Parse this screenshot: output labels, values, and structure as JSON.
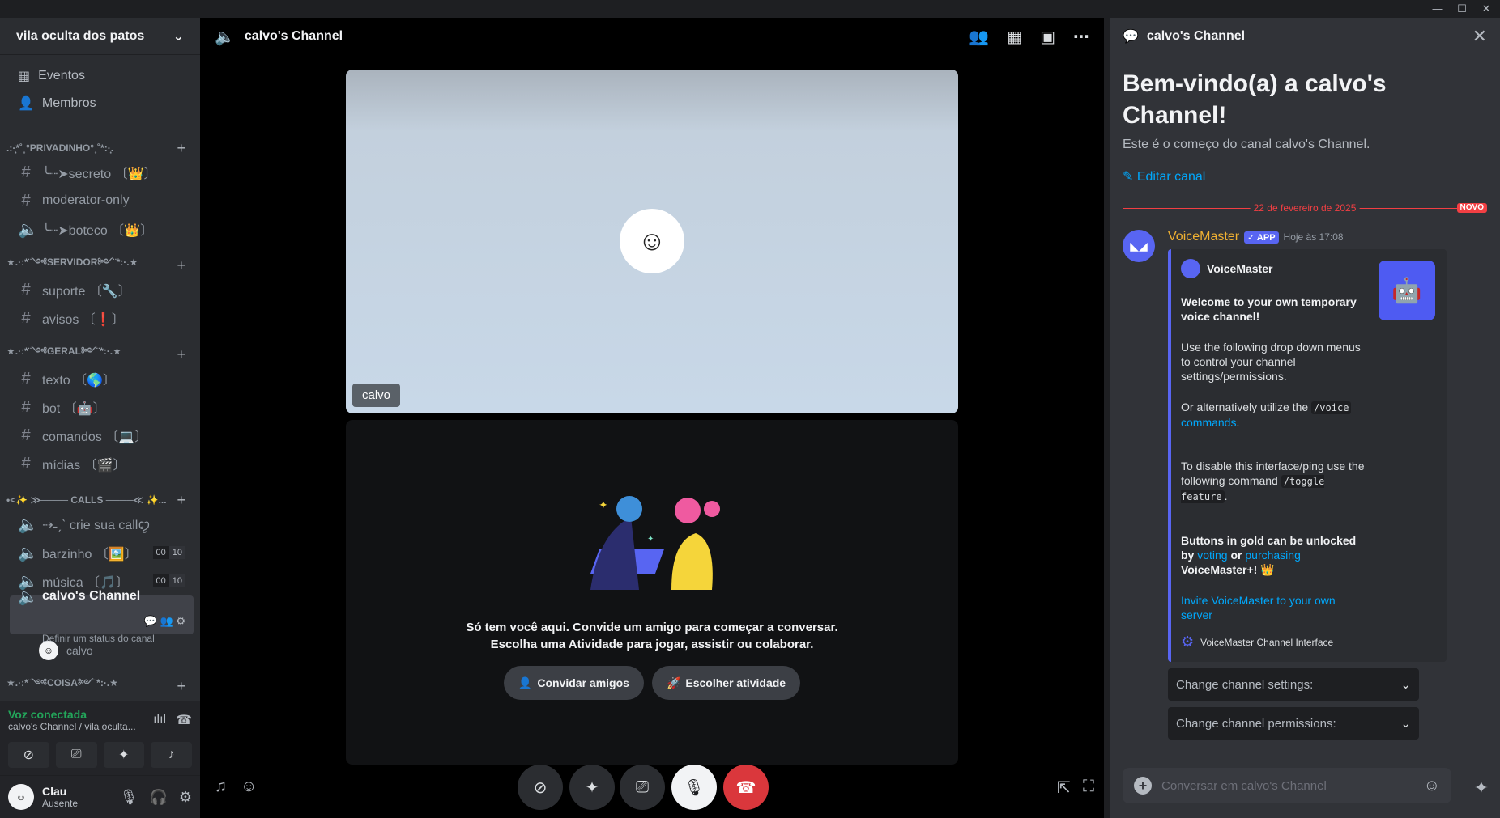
{
  "window": {
    "minimize": "—",
    "maximize": "☐",
    "close": "✕"
  },
  "sidebar": {
    "server_name": "vila oculta dos patos",
    "nav": [
      {
        "icon": "calendar-icon",
        "label": "Eventos"
      },
      {
        "icon": "members-icon",
        "label": "Membros"
      }
    ],
    "categories": [
      {
        "name": ".:·̩͙*˚˳°PRIVADINHO°˳˚*:·̩͙.",
        "channels": [
          {
            "type": "text-locked",
            "label": "╰┈➤secreto 〔👑〕"
          },
          {
            "type": "text",
            "label": "moderator-only"
          },
          {
            "type": "voice-locked",
            "label": "╰┈➤boteco 〔👑〕"
          }
        ]
      },
      {
        "name": "★.·:*¨༺SERVIDOR༻¨*:·.★",
        "channels": [
          {
            "type": "text",
            "label": "suporte 〔🔧〕"
          },
          {
            "type": "text",
            "label": "avisos 〔❗〕"
          }
        ]
      },
      {
        "name": "★.·:*¨༺GERAL༻¨*:·.★",
        "channels": [
          {
            "type": "text",
            "label": "texto 〔🌎〕"
          },
          {
            "type": "text",
            "label": "bot 〔🤖〕"
          },
          {
            "type": "text",
            "label": "comandos 〔💻〕"
          },
          {
            "type": "text",
            "label": "mídias 〔🎬〕"
          }
        ]
      },
      {
        "name": "•<✨ ≫──── CALLS ────≪ ✨...",
        "channels": [
          {
            "type": "voice",
            "label": "⇢˗ˏˋ crie sua callꨄ"
          },
          {
            "type": "voice",
            "label": "barzinho 〔🖼️〕",
            "count": "00",
            "limit": "10"
          },
          {
            "type": "voice",
            "label": "música 〔🎵〕",
            "count": "00",
            "limit": "10"
          }
        ]
      }
    ],
    "active_channel": {
      "label": "calvo's Channel",
      "status": "Definir um status do canal"
    },
    "active_member": "calvo",
    "collapsed_category": "★.·:*¨༺COISA༻¨*:·.★",
    "voice_status": "Voz conectada",
    "voice_location": "calvo's Channel / vila oculta...",
    "user": {
      "name": "Clau",
      "status": "Ausente"
    }
  },
  "main": {
    "channel_title": "calvo's Channel",
    "tile_name": "calvo",
    "empty_line1": "Só tem você aqui. Convide um amigo para começar a conversar.",
    "empty_line2": "Escolha uma Atividade para jogar, assistir ou colaborar.",
    "invite_btn": "Convidar amigos",
    "activity_btn": "Escolher atividade"
  },
  "panel": {
    "title": "calvo's Channel",
    "welcome": "Bem-vindo(a) a calvo's Channel!",
    "desc": "Este é o começo do canal calvo's Channel.",
    "edit": "Editar canal",
    "date_divider": "22 de fevereiro de 2025",
    "new_badge": "NOVO",
    "message": {
      "author": "VoiceMaster",
      "app_tag": "✓ APP",
      "timestamp": "Hoje às 17:08",
      "embed_author": "VoiceMaster",
      "title": "Welcome to your own temporary voice channel!",
      "p1": "Use the following drop down menus to control your channel settings/permissions.",
      "p2a": "Or alternatively utilize the ",
      "p2code": "/voice",
      "p2link": "commands",
      "p2end": ".",
      "p3a": "To disable this interface/ping use the following command ",
      "p3code": "/toggle feature",
      "p3end": ".",
      "p4a": "Buttons in gold can be unlocked by ",
      "p4voting": "voting",
      "p4or": " or ",
      "p4purchasing": "purchasing",
      "p4end": " VoiceMaster+! 👑",
      "p5link": "Invite VoiceMaster to your own server",
      "footer": "VoiceMaster Channel Interface"
    },
    "select1": "Change channel settings:",
    "select2": "Change channel permissions:",
    "chat_placeholder": "Conversar em calvo's Channel"
  },
  "colors": {
    "accent": "#5865f2",
    "connected": "#23a55a",
    "hangup": "#da373c",
    "new": "#f23f43",
    "author": "#f0b132"
  }
}
